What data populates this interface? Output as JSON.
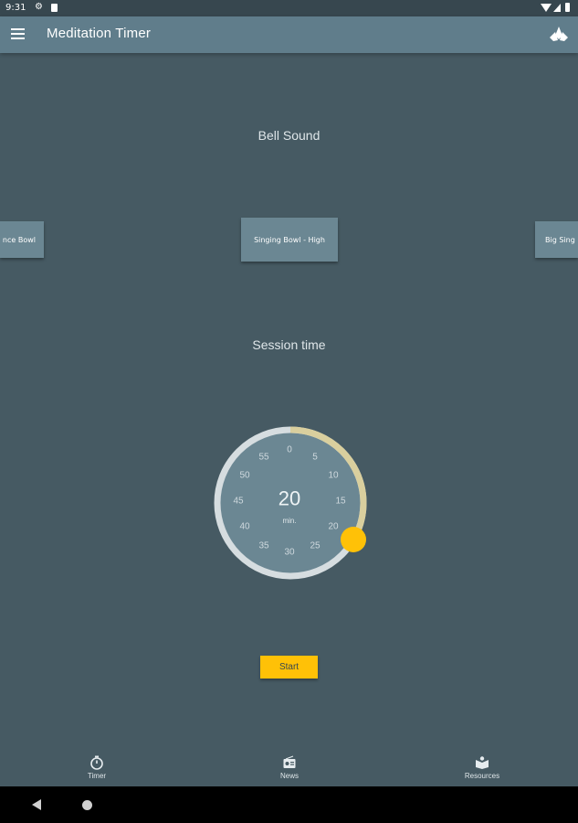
{
  "status_bar": {
    "time": "9:31",
    "icons": [
      "gear-icon",
      "sd-card-icon",
      "wifi-icon",
      "signal-icon",
      "battery-icon"
    ]
  },
  "app_bar": {
    "title": "Meditation Timer",
    "menu_icon": "menu-icon",
    "action_icon": "lotus-icon",
    "color": "#607d8b"
  },
  "bell_section": {
    "title": "Bell Sound",
    "options": [
      {
        "label": "nce Bowl"
      },
      {
        "label": "Singing Bowl - High"
      },
      {
        "label": "Big Sing"
      }
    ],
    "selected": "Singing Bowl - High"
  },
  "session_section": {
    "title": "Session time",
    "value": "20",
    "unit": "min.",
    "selected_minutes": 20,
    "max_minutes": 60,
    "ticks": [
      "0",
      "5",
      "10",
      "15",
      "20",
      "25",
      "30",
      "35",
      "40",
      "45",
      "50",
      "55"
    ],
    "accent": "#ffc107",
    "progress_color": "#d9cf9e"
  },
  "start_button": {
    "label": "Start"
  },
  "bottom_nav": [
    {
      "label": "Timer",
      "icon": "stopwatch-icon"
    },
    {
      "label": "News",
      "icon": "radio-icon"
    },
    {
      "label": "Resources",
      "icon": "book-icon"
    }
  ],
  "colors": {
    "background": "#465a63",
    "accent": "#ffc107",
    "system_nav": "#000000"
  }
}
